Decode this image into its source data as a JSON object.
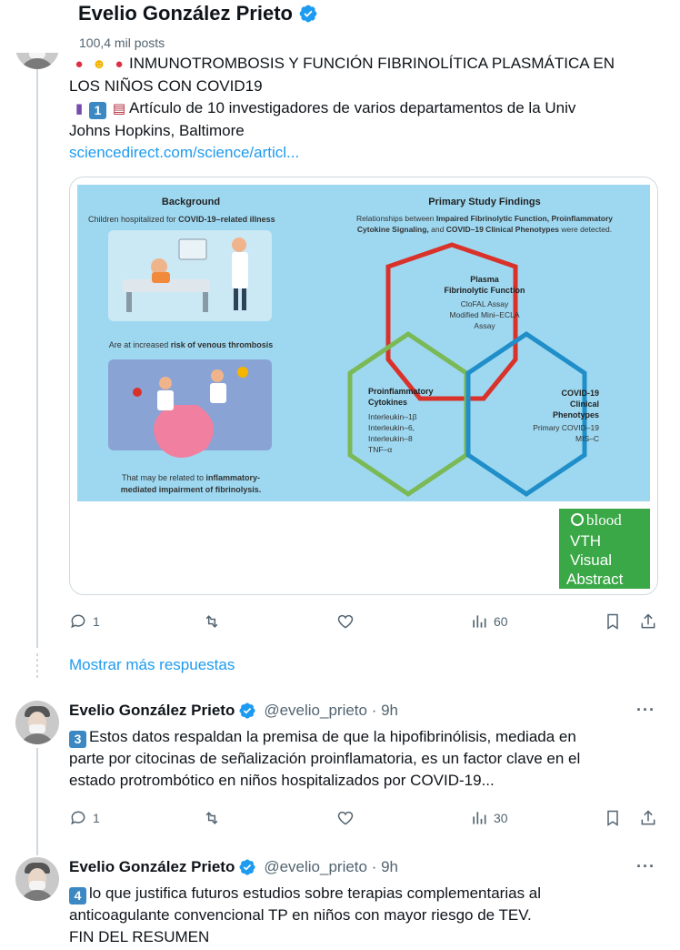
{
  "header": {
    "name": "Evelio González Prieto",
    "posts": "100,4 mil posts"
  },
  "tweet1": {
    "line1": "INMUNOTROMBOSIS Y FUNCIÓN FIBRINOLÍTICA PLASMÁTICA EN",
    "line2": "LOS NIÑOS CON COVID19",
    "line3": "Artículo de 10 investigadores de varios departamentos de la Univ",
    "line4": "Johns Hopkins, Baltimore",
    "link": "sciencedirect.com/science/articl...",
    "emojis": [
      "blood-drop",
      "virus-face",
      "blood-drop"
    ],
    "thread_number": "1",
    "actions": {
      "replies": "1",
      "views": "60"
    }
  },
  "media": {
    "background_title": "Background",
    "background_sub": "Children hospitalized for",
    "background_sub_bold": "COVID-19–related illness",
    "risk_text": "Are at increased",
    "risk_bold": "risk of venous thrombosis",
    "related_line1": "That may be related to",
    "related_bold1": "inflammatory-",
    "related_bold2": "mediated impairment of fibrinolysis.",
    "findings_title": "Primary Study Findings",
    "findings_line1_a": "Relationships between",
    "findings_line1_b": "Impaired Fibrinolytic Function, Proinflammatory",
    "findings_line2_b": "Cytokine Signaling,",
    "findings_line2_c": "and",
    "findings_line2_d": "COVID–19 Clinical Phenotypes",
    "findings_line2_e": "were detected.",
    "hex_plasma_title1": "Plasma",
    "hex_plasma_title2": "Fibrinolytic Function",
    "hex_plasma_items": [
      "CloFAL Assay",
      "Modified Mini–ECLA",
      "Assay"
    ],
    "hex_cyto_title1": "Proinflammatory",
    "hex_cyto_title2": "Cytokines",
    "hex_cyto_items": [
      "Interleukin–1β",
      "Interleukin–6,",
      "Interleukin–8",
      "TNF–α"
    ],
    "hex_covid_title1": "COVID-19",
    "hex_covid_title2": "Clinical",
    "hex_covid_title3": "Phenotypes",
    "hex_covid_items": [
      "Primary COVID–19",
      "MIS–C"
    ],
    "badge_brand": "blood",
    "badge_vth": "VTH",
    "badge_visual": "Visual",
    "badge_abstract": "Abstract",
    "colors": {
      "panel": "#9ed8f0",
      "red": "#d9322b",
      "green": "#7ab955",
      "blue": "#1f8ec9",
      "badge": "#3aa847"
    }
  },
  "more_replies": "Mostrar más respuestas",
  "tweet2": {
    "name": "Evelio González Prieto",
    "handle": "@evelio_prieto · 9h",
    "number": "3",
    "line1": "Estos datos respaldan la premisa de que la hipofibrinólisis, mediada en",
    "line2": "parte por citocinas de señalización proinflamatoria, es un factor clave en el",
    "line3": "estado protrombótico en niños hospitalizados por COVID-19...",
    "actions": {
      "replies": "1",
      "views": "30"
    },
    "more": "···"
  },
  "tweet3": {
    "name": "Evelio González Prieto",
    "handle": "@evelio_prieto · 9h",
    "number": "4",
    "line1": "lo que justifica futuros estudios sobre terapias complementarias al",
    "line2": "anticoagulante convencional TP en niños con mayor riesgo de TEV.",
    "line3": "FIN DEL RESUMEN",
    "more": "···"
  }
}
